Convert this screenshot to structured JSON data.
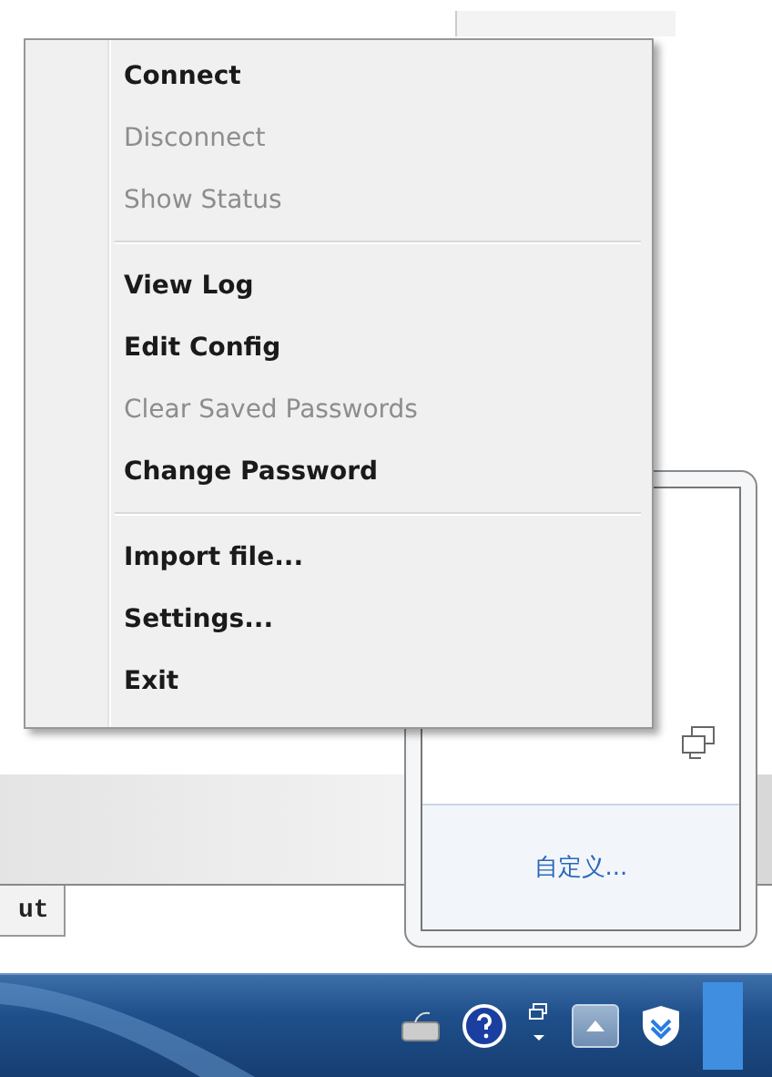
{
  "context_menu": {
    "groups": [
      [
        {
          "label": "Connect",
          "disabled": false
        },
        {
          "label": "Disconnect",
          "disabled": true
        },
        {
          "label": "Show Status",
          "disabled": true
        }
      ],
      [
        {
          "label": "View Log",
          "disabled": false
        },
        {
          "label": "Edit Config",
          "disabled": false
        },
        {
          "label": "Clear Saved Passwords",
          "disabled": true
        },
        {
          "label": "Change Password",
          "disabled": false
        }
      ],
      [
        {
          "label": "Import file...",
          "disabled": false
        },
        {
          "label": "Settings...",
          "disabled": false
        },
        {
          "label": "Exit",
          "disabled": false
        }
      ]
    ]
  },
  "background_window": {
    "tab": "ut"
  },
  "tray_popup": {
    "customize_link": "自定义..."
  }
}
